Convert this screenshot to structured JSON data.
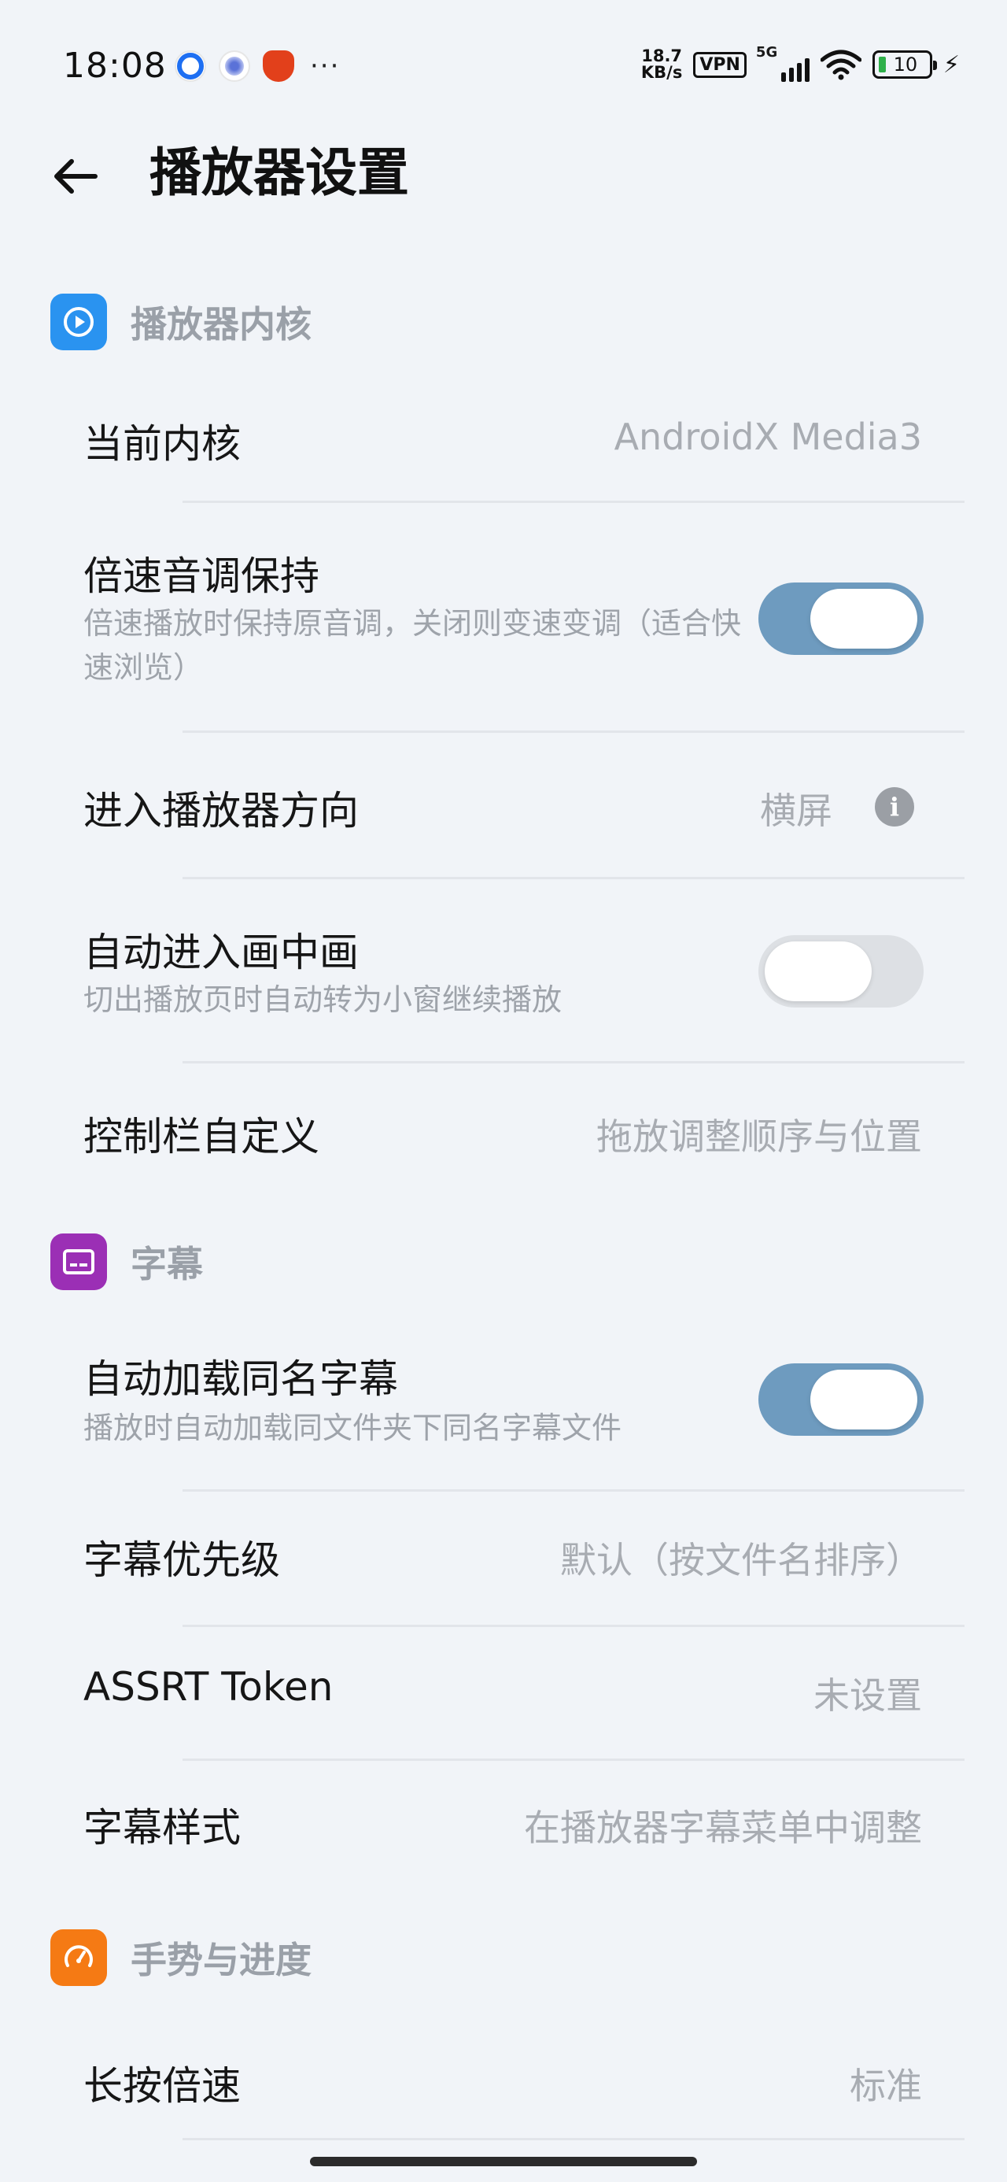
{
  "status_bar": {
    "time": "18:08",
    "more": "···",
    "net_speed_value": "18.7",
    "net_speed_unit": "KB/s",
    "vpn": "VPN",
    "signal_label": "5G",
    "battery": "10",
    "charging_icon": "bolt-icon"
  },
  "header": {
    "title": "播放器设置",
    "back_icon": "arrow-left-icon"
  },
  "sections": {
    "core": {
      "title": "播放器内核",
      "icon": "play-circle-icon",
      "color": "#2a93f0",
      "rows": {
        "current_core": {
          "title": "当前内核",
          "value": "AndroidX Media3"
        },
        "pitch_keep": {
          "title": "倍速音调保持",
          "subtitle": "倍速播放时保持原音调，关闭则变速变调（适合快速浏览）",
          "enabled": true
        },
        "orientation": {
          "title": "进入播放器方向",
          "value": "横屏"
        },
        "pip": {
          "title": "自动进入画中画",
          "subtitle": "切出播放页时自动转为小窗继续播放",
          "enabled": false
        },
        "control_bar": {
          "title": "控制栏自定义",
          "value": "拖放调整顺序与位置"
        }
      }
    },
    "subtitle": {
      "title": "字幕",
      "icon": "subtitles-icon",
      "color": "#9b2fb5",
      "rows": {
        "auto_load": {
          "title": "自动加载同名字幕",
          "subtitle": "播放时自动加载同文件夹下同名字幕文件",
          "enabled": true
        },
        "priority": {
          "title": "字幕优先级",
          "value": "默认（按文件名排序）"
        },
        "assrt": {
          "title": "ASSRT Token",
          "value": "未设置"
        },
        "style": {
          "title": "字幕样式",
          "value": "在播放器字幕菜单中调整"
        }
      }
    },
    "gesture": {
      "title": "手势与进度",
      "icon": "speedometer-icon",
      "color": "#f57a14",
      "rows": {
        "long_press": {
          "title": "长按倍速",
          "value": "标准"
        }
      }
    }
  },
  "colors": {
    "background": "#f1f4f8",
    "toggle_on": "#6e9bbf",
    "toggle_off": "#dde0e4"
  }
}
